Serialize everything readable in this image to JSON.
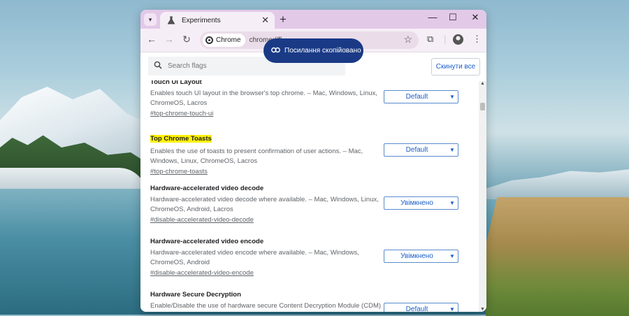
{
  "window": {
    "tab_title": "Experiments",
    "tab_icon": "flask-icon"
  },
  "toolbar": {
    "chip_label": "Chrome",
    "url_visible": "chrome://fl"
  },
  "toast": {
    "icon": "link-icon",
    "text": "Посилання скопійовано"
  },
  "search": {
    "placeholder": "Search flags"
  },
  "reset_button": "Скинути все",
  "flags": [
    {
      "title": "Touch UI Layout",
      "highlighted": false,
      "description": "Enables touch UI layout in the browser's top chrome. – Mac, Windows, Linux, ChromeOS, Lacros",
      "link": "#top-chrome-touch-ui",
      "value": "Default"
    },
    {
      "title": "Top Chrome Toasts",
      "highlighted": true,
      "description": "Enables the use of toasts to present confirmation of user actions. – Mac, Windows, Linux, ChromeOS, Lacros",
      "link": "#top-chrome-toasts",
      "value": "Default"
    },
    {
      "title": "Hardware-accelerated video decode",
      "highlighted": false,
      "description": "Hardware-accelerated video decode where available. – Mac, Windows, Linux, ChromeOS, Android, Lacros",
      "link": "#disable-accelerated-video-decode",
      "value": "Увімкнено"
    },
    {
      "title": "Hardware-accelerated video encode",
      "highlighted": false,
      "description": "Hardware-accelerated video encode where available. – Mac, Windows, ChromeOS, Android",
      "link": "#disable-accelerated-video-encode",
      "value": "Увімкнено"
    },
    {
      "title": "Hardware Secure Decryption",
      "highlighted": false,
      "description": "Enable/Disable the use of hardware secure Content Decryption Module (CDM) for",
      "link": "",
      "value": "Default"
    }
  ],
  "colors": {
    "titlebar": "#e3c9e8",
    "toast": "#1a3a86",
    "accent": "#1a5dc9",
    "highlight": "#fff200"
  }
}
